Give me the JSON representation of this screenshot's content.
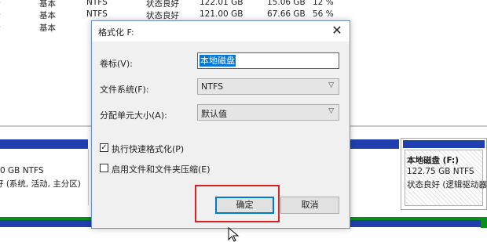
{
  "volumes": [
    {
      "dash": "-",
      "type": "基本",
      "fs": "NTFS",
      "status": "状态良好",
      "capacity": "122.01 GB",
      "free": "15.06 GB",
      "pct": "12 %"
    },
    {
      "dash": "-",
      "type": "基本",
      "fs": "NTFS",
      "status": "状态良好",
      "capacity": "121.00 GB",
      "free": "67.66 GB",
      "pct": "56 %"
    },
    {
      "dash": "-",
      "type": "基本",
      "fs": "",
      "status": "",
      "capacity": "",
      "free": "",
      "pct": ""
    }
  ],
  "disk_map": {
    "left_partition": {
      "size": "0 GB NTFS",
      "status": "好 (系统, 活动, 主分区)"
    },
    "f_partition": {
      "name": "本地磁盘  (F:)",
      "size": "122.75 GB NTFS",
      "status": "状态良好 (逻辑驱动器"
    }
  },
  "dialog": {
    "title": "格式化 F:",
    "volume_label_label": "卷标(V):",
    "volume_label_value": "本地磁盘",
    "filesystem_label": "文件系统(F):",
    "filesystem_value": "NTFS",
    "allocation_label": "分配单元大小(A):",
    "allocation_value": "默认值",
    "quick_format_label": "执行快速格式化(P)",
    "quick_format_checked": "✓",
    "compression_label": "启用文件和文件夹压缩(E)",
    "ok_label": "确定",
    "cancel_label": "取消",
    "close_glyph": "✕",
    "dropdown_glyph": "▽"
  },
  "colors": {
    "accent": "#0078d7",
    "highlight": "#e01f1f",
    "volume_bar": "#1f3fae",
    "primary_bar": "#0a8c1e"
  }
}
